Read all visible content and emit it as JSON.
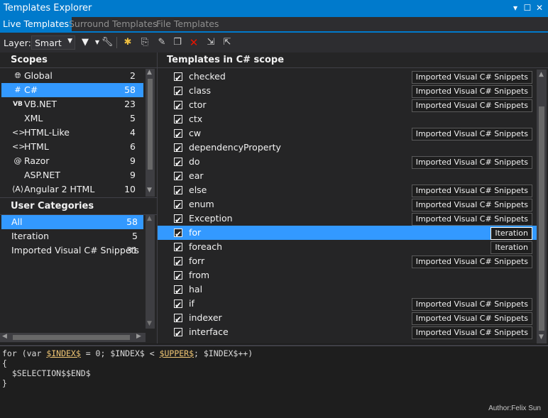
{
  "window": {
    "title": "Templates Explorer"
  },
  "tabs": [
    {
      "label": "Live Templates"
    },
    {
      "label": "Surround Templates"
    },
    {
      "label": "File Templates"
    }
  ],
  "toolbar": {
    "layer_label": "Layer:",
    "layer_value": "Smart"
  },
  "scopes": {
    "header": "Scopes",
    "items": [
      {
        "icon": "globe-icon",
        "label": "Global",
        "count": "2"
      },
      {
        "icon": "hash-icon",
        "label": "C#",
        "count": "58"
      },
      {
        "icon": "vb-icon",
        "label": "VB.NET",
        "count": "23"
      },
      {
        "icon": "xml-icon",
        "label": "XML",
        "count": "5"
      },
      {
        "icon": "html-icon",
        "label": "HTML-Like",
        "count": "4"
      },
      {
        "icon": "html-icon",
        "label": "HTML",
        "count": "6"
      },
      {
        "icon": "at-icon",
        "label": "Razor",
        "count": "9"
      },
      {
        "icon": "aspnet-icon",
        "label": "ASP.NET",
        "count": "9"
      },
      {
        "icon": "angular-icon",
        "label": "Angular 2 HTML",
        "count": "10"
      }
    ]
  },
  "categories": {
    "header": "User Categories",
    "items": [
      {
        "label": "All",
        "count": "58"
      },
      {
        "label": "Iteration",
        "count": "5"
      },
      {
        "label": "Imported Visual C# Snippets",
        "count": "31"
      }
    ]
  },
  "templates": {
    "header": "Templates in C# scope",
    "items": [
      {
        "name": "checked",
        "tag": "Imported Visual C# Snippets"
      },
      {
        "name": "class",
        "tag": "Imported Visual C# Snippets"
      },
      {
        "name": "ctor",
        "tag": "Imported Visual C# Snippets"
      },
      {
        "name": "ctx",
        "tag": ""
      },
      {
        "name": "cw",
        "tag": "Imported Visual C# Snippets"
      },
      {
        "name": "dependencyProperty",
        "tag": ""
      },
      {
        "name": "do",
        "tag": "Imported Visual C# Snippets"
      },
      {
        "name": "ear",
        "tag": ""
      },
      {
        "name": "else",
        "tag": "Imported Visual C# Snippets"
      },
      {
        "name": "enum",
        "tag": "Imported Visual C# Snippets"
      },
      {
        "name": "Exception",
        "tag": "Imported Visual C# Snippets"
      },
      {
        "name": "for",
        "tag": "Iteration"
      },
      {
        "name": "foreach",
        "tag": "Iteration"
      },
      {
        "name": "forr",
        "tag": "Imported Visual C# Snippets"
      },
      {
        "name": "from",
        "tag": ""
      },
      {
        "name": "hal",
        "tag": ""
      },
      {
        "name": "if",
        "tag": "Imported Visual C# Snippets"
      },
      {
        "name": "indexer",
        "tag": "Imported Visual C# Snippets"
      },
      {
        "name": "interface",
        "tag": "Imported Visual C# Snippets"
      }
    ]
  },
  "editor": {
    "line1": {
      "a": "for (var ",
      "b": "$INDEX$",
      "c": " = 0; $INDEX$ < ",
      "d": "$UPPER$",
      "e": "; $INDEX$++)"
    },
    "line2": "{",
    "line3": "  $SELECTION$$END$",
    "line4": "}",
    "author": "Author:Felix Sun"
  },
  "colors": {
    "accent": "#007acc",
    "selection": "#3399ff",
    "background": "#252526"
  }
}
